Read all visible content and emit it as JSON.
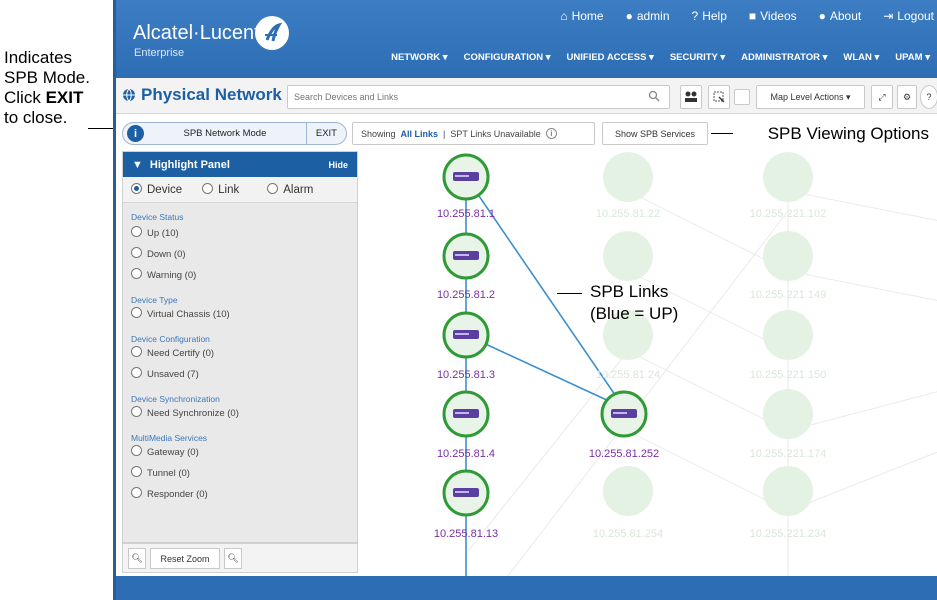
{
  "annotations": {
    "left_note_line1": "Indicates",
    "left_note_line2": "SPB Mode.",
    "left_note_line3_prefix": "Click ",
    "left_note_line3_bold": "EXIT",
    "left_note_line4": "to close.",
    "right_note": "SPB Viewing Options",
    "links_note_line1": "SPB Links",
    "links_note_line2": "(Blue = UP)"
  },
  "header": {
    "logo": "Alcatel·Lucent",
    "logo_sub": "Enterprise",
    "top_links": [
      {
        "label": "Home",
        "icon": "home-icon"
      },
      {
        "label": "admin",
        "icon": "user-icon"
      },
      {
        "label": "Help",
        "icon": "help-icon"
      },
      {
        "label": "Videos",
        "icon": "video-icon"
      },
      {
        "label": "About",
        "icon": "info-icon"
      },
      {
        "label": "Logout",
        "icon": "logout-icon"
      }
    ],
    "nav": [
      "NETWORK",
      "CONFIGURATION",
      "UNIFIED ACCESS",
      "SECURITY",
      "ADMINISTRATOR",
      "WLAN",
      "UPAM"
    ]
  },
  "toolbar": {
    "title": "Physical Network",
    "search_placeholder": "Search Devices and Links",
    "map_actions": "Map Level Actions"
  },
  "spb": {
    "mode_label": "SPB Network Mode",
    "exit_label": "EXIT",
    "showing_prefix": "Showing",
    "showing_value": "All Links",
    "spt_status": "SPT Links Unavailable",
    "show_services": "Show SPB Services"
  },
  "panel": {
    "title": "Highlight Panel",
    "hide": "Hide",
    "tabs": [
      "Device",
      "Link",
      "Alarm"
    ],
    "groups": [
      {
        "title": "Device Status",
        "options": [
          "Up (10)",
          "Down (0)",
          "Warning (0)"
        ]
      },
      {
        "title": "Device Type",
        "options": [
          "Virtual Chassis (10)"
        ]
      },
      {
        "title": "Device Configuration",
        "options": [
          "Need Certify (0)",
          "Unsaved (7)"
        ]
      },
      {
        "title": "Device Synchronization",
        "options": [
          "Need Synchronize (0)"
        ]
      },
      {
        "title": "MultiMedia Services",
        "options": [
          "Gateway (0)",
          "Tunnel (0)",
          "Responder (0)"
        ]
      }
    ],
    "reset_zoom": "Reset Zoom"
  },
  "map": {
    "active_nodes": [
      "10.255.81.1",
      "10.255.81.2",
      "10.255.81.3",
      "10.255.81.4",
      "10.255.81.13",
      "10.255.81.252"
    ],
    "faded_nodes": [
      "10.255.81.22",
      "10.255.221.102",
      "10.255.221.149",
      "10.255.221.150",
      "10.255.81.24",
      "10.255.221.174",
      "10.255.81.254",
      "10.255.221.234"
    ],
    "link_color": "#3a8fd0",
    "node_ring_color": "#2e9b36"
  }
}
